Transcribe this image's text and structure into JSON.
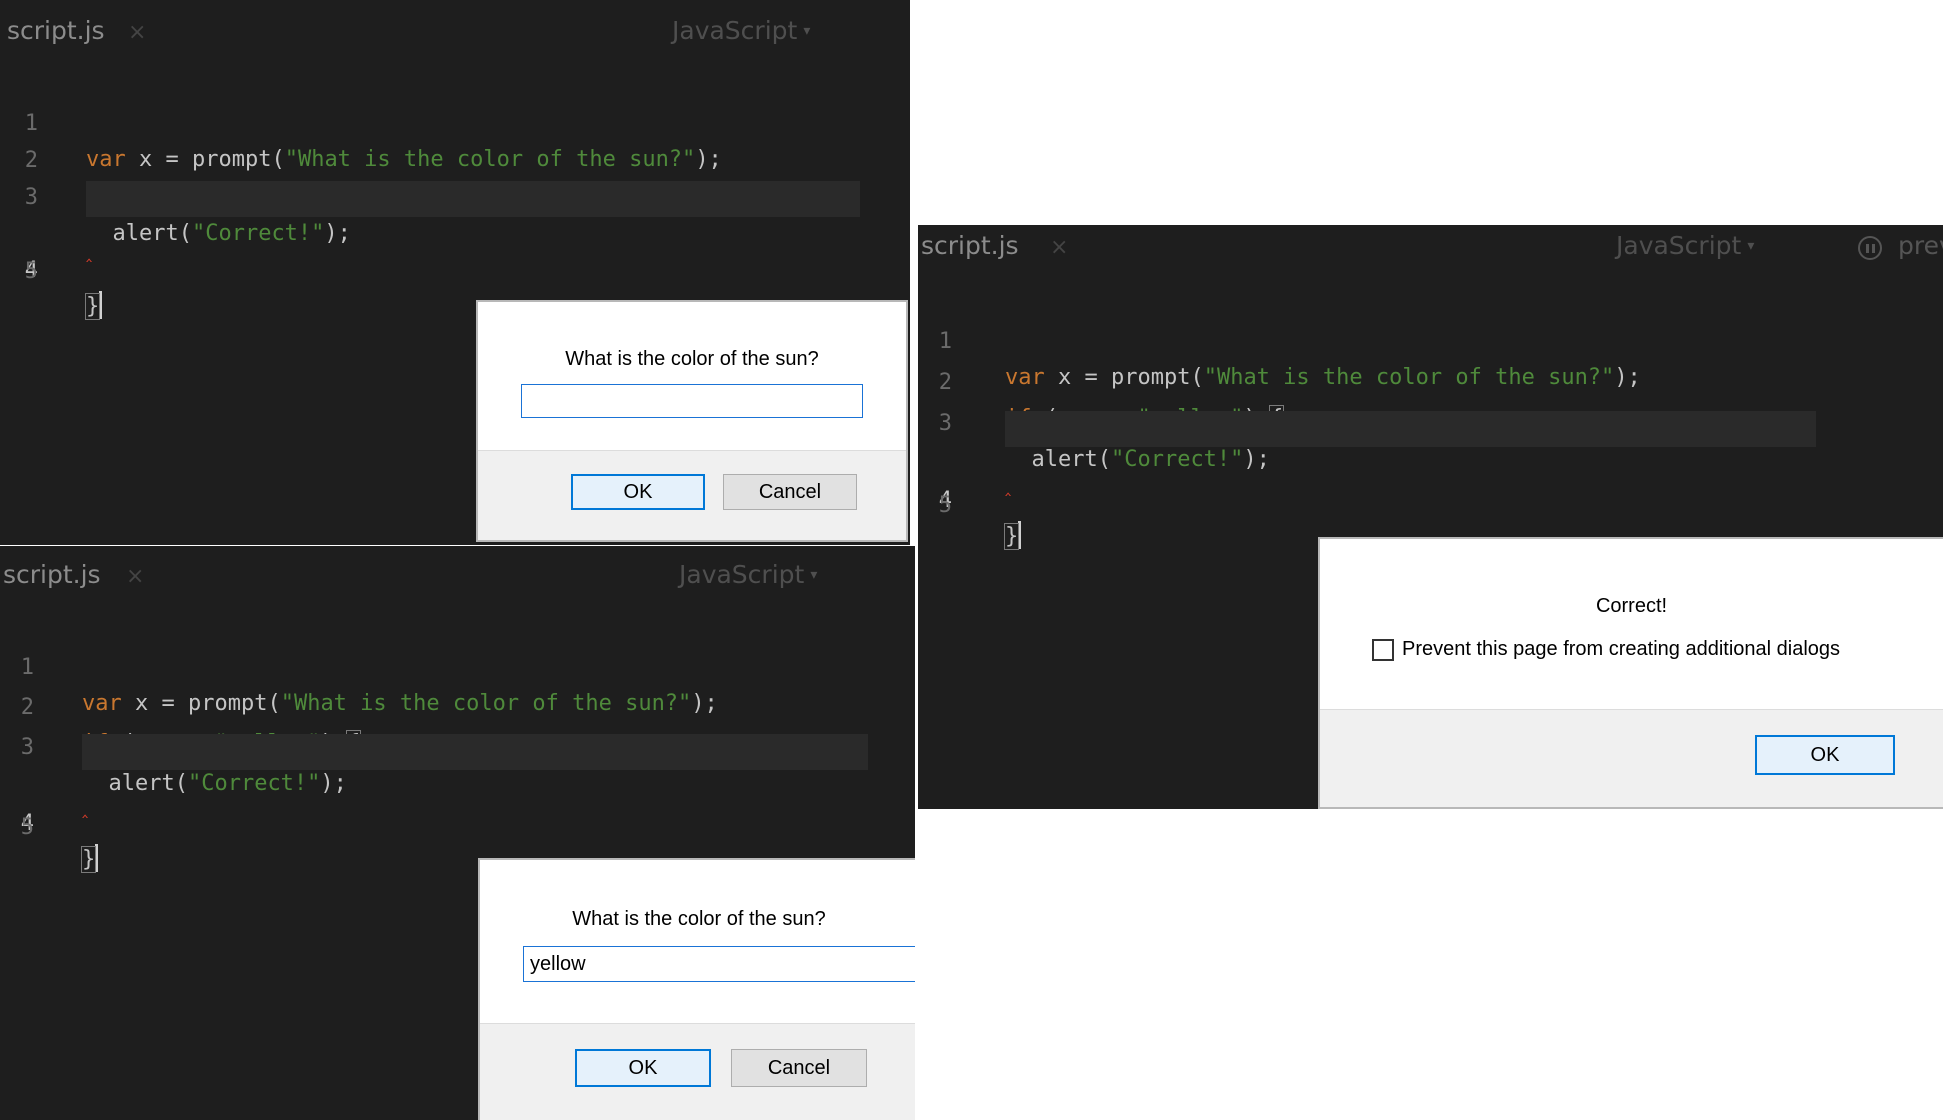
{
  "editor": {
    "filename": "script.js",
    "close_glyph": "×",
    "language": "JavaScript",
    "caret": "▾",
    "preview_label": "prev",
    "line_numbers": [
      "1",
      "2",
      "3",
      "4",
      "5"
    ],
    "code": {
      "l1_kw": "var",
      "l1_a": " x = prompt(",
      "l1_str": "\"What is the color of the sun?\"",
      "l1_b": ");",
      "l2_kw": "if",
      "l2_a": " (x === ",
      "l2_str": "\"yellow\"",
      "l2_b": ") ",
      "l2_brace": "{",
      "l3_a": "  alert(",
      "l3_str": "\"Correct!\"",
      "l3_b": ");",
      "l4_brace": "}",
      "squiggle": "‸"
    }
  },
  "prompt_dialog_empty": {
    "message": "What is the color of the sun?",
    "input_value": "",
    "ok_label": "OK",
    "cancel_label": "Cancel"
  },
  "prompt_dialog_filled": {
    "message": "What is the color of the sun?",
    "input_value": "yellow",
    "ok_label": "OK",
    "cancel_label": "Cancel"
  },
  "alert_dialog": {
    "message": "Correct!",
    "checkbox_label": "Prevent this page from creating additional dialogs",
    "checkbox_checked": false,
    "ok_label": "OK"
  },
  "colors": {
    "editor_bg": "#1e1e1e",
    "keyword": "#c9772f",
    "string": "#4f8a3b",
    "focus_blue": "#0078d7"
  }
}
